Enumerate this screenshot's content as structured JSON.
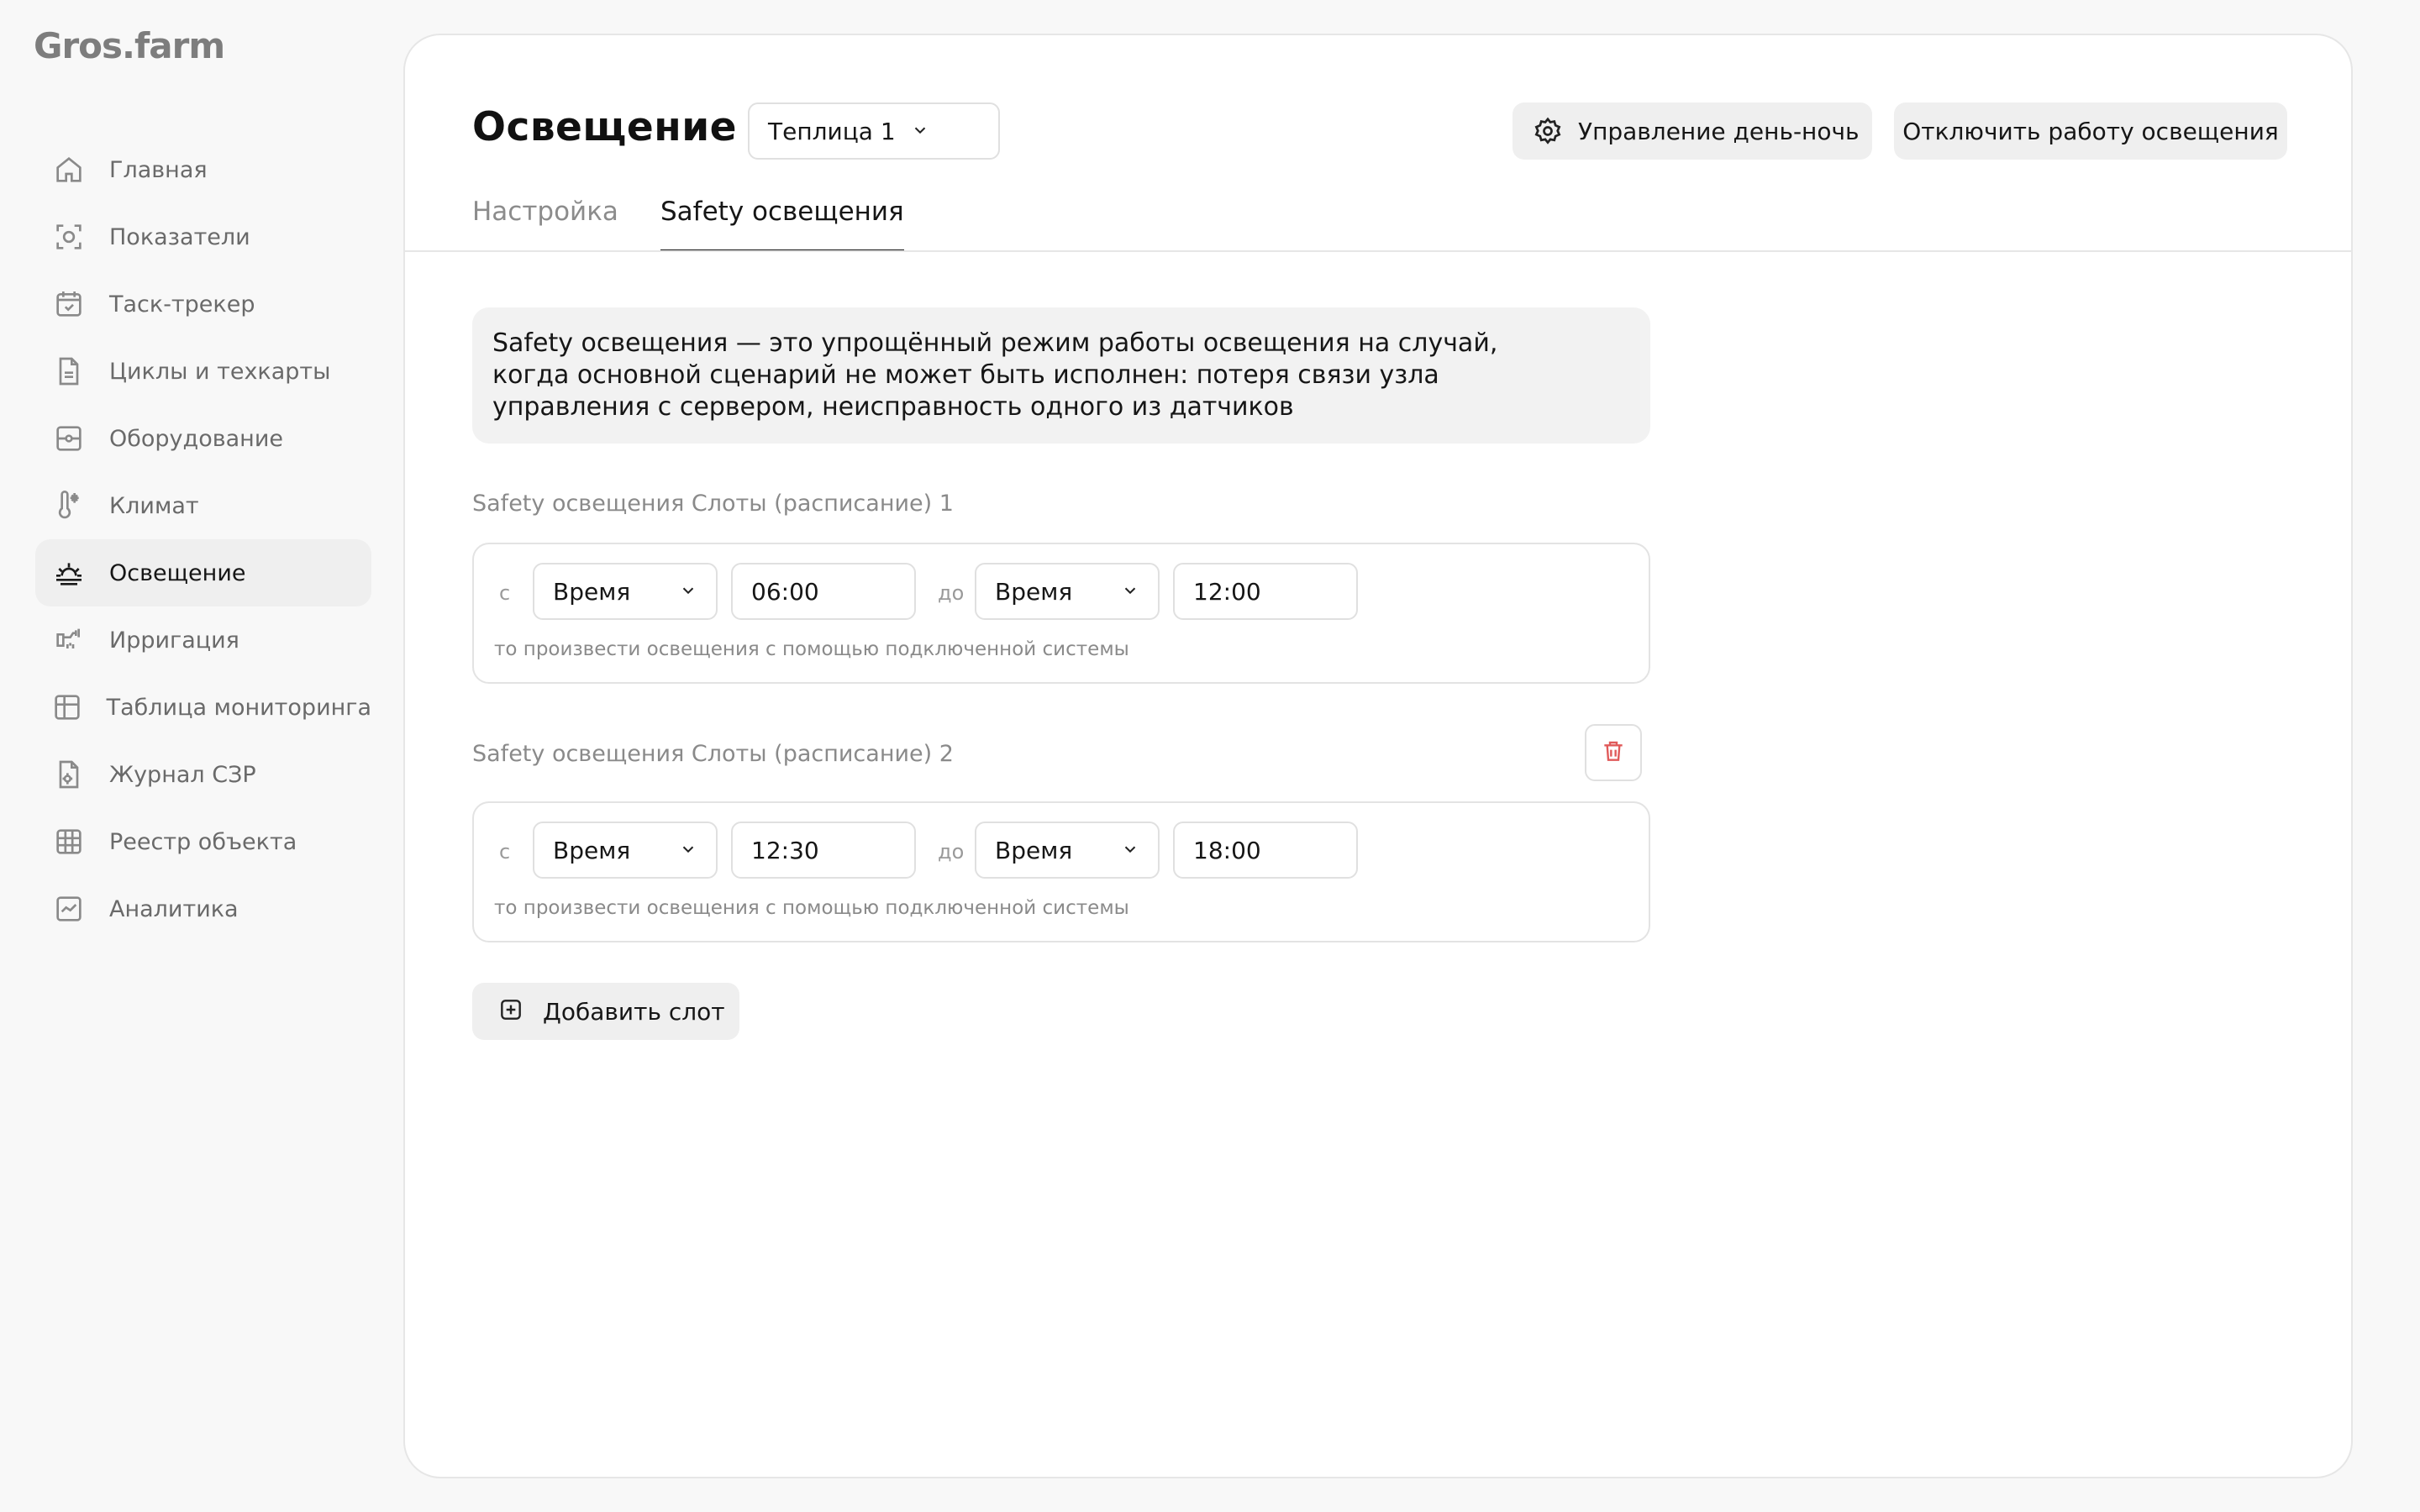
{
  "app": {
    "logo": "Gros.farm"
  },
  "sidebar": {
    "items": [
      {
        "label": "Главная",
        "icon": "home-icon"
      },
      {
        "label": "Показатели",
        "icon": "indicators-icon"
      },
      {
        "label": "Таск-трекер",
        "icon": "calendar-check-icon"
      },
      {
        "label": "Циклы и техкарты",
        "icon": "document-icon"
      },
      {
        "label": "Оборудование",
        "icon": "equipment-icon"
      },
      {
        "label": "Климат",
        "icon": "thermometer-snow-icon"
      },
      {
        "label": "Освещение",
        "icon": "sunrise-icon",
        "active": true
      },
      {
        "label": "Ирригация",
        "icon": "irrigation-icon"
      },
      {
        "label": "Таблица мониторинга",
        "icon": "table-icon"
      },
      {
        "label": "Журнал СЗР",
        "icon": "journal-icon"
      },
      {
        "label": "Реестр объекта",
        "icon": "grid-icon"
      },
      {
        "label": "Аналитика",
        "icon": "chart-icon"
      }
    ]
  },
  "header": {
    "title": "Освещение",
    "greenhouse_select": "Теплица 1",
    "daynight_button": "Управление день-ночь",
    "disable_button": "Отключить работу освещения"
  },
  "tabs": {
    "settings": "Настройка",
    "safety": "Safety освещения"
  },
  "info": {
    "line1": "Safety освещения — это упрощённый режим работы освещения на случай,",
    "line2": "когда основной сценарий не может быть исполнен: потеря связи узла",
    "line3": "управления с сервером,  неисправность одного из датчиков"
  },
  "slots": [
    {
      "title": "Safety освещения Слоты (расписание) 1",
      "from_label": "с",
      "from_type": "Время",
      "from_value": "06:00",
      "to_label": "до",
      "to_type": "Время",
      "to_value": "12:00",
      "hint": "то произвести освещения с помощью подключенной системы"
    },
    {
      "title": "Safety освещения Слоты (расписание) 2",
      "from_label": "с",
      "from_type": "Время",
      "from_value": "12:30",
      "to_label": "до",
      "to_type": "Время",
      "to_value": "18:00",
      "hint": "то произвести освещения с помощью подключенной системы"
    }
  ],
  "add_slot": "Добавить слот",
  "colors": {
    "accent_delete": "#e05a5a",
    "active_nav_bg": "#efefef"
  }
}
